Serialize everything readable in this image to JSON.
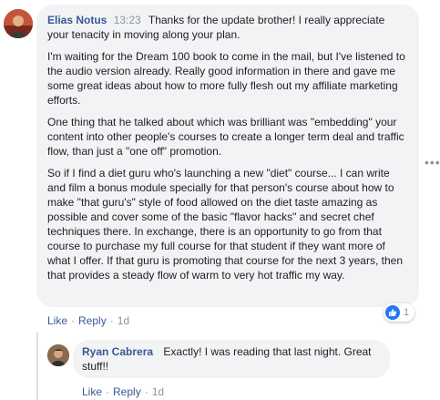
{
  "comment": {
    "author": "Elias Notus",
    "time": "13:23",
    "paragraphs": [
      "Thanks for the update brother! I really appreciate your tenacity in moving along your plan.",
      "I'm waiting for the Dream 100 book to come in the mail, but I've listened to the audio version already. Really good information in there and gave me some great ideas about how to more fully flesh out my affiliate marketing efforts.",
      "One thing that he talked about which was brilliant was \"embedding\" your content into other people's courses to create a longer term deal and traffic flow, than just a \"one off\" promotion.",
      "So if I find a diet guru who's launching a new \"diet\" course... I can write and film a bonus module specially for that person's course about how to make \"that guru's\" style of food allowed on the diet taste amazing as possible and cover some of the basic \"flavor hacks\" and secret chef techniques there. In exchange, there is an opportunity to go from that course to purchase my full course for that student if they want more of what I offer. If that guru is promoting that course for the next 3 years, then that provides a steady flow of warm to very hot traffic my way."
    ],
    "reaction_count": "1",
    "actions": {
      "like": "Like",
      "reply": "Reply",
      "age": "1d"
    }
  },
  "reply": {
    "author": "Ryan Cabrera",
    "text": "Exactly! I was reading that last night. Great stuff!!",
    "actions": {
      "like": "Like",
      "reply": "Reply",
      "age": "1d"
    }
  },
  "colors": {
    "link": "#385898",
    "bubble": "#f2f3f5",
    "meta": "#90949c",
    "like_blue": "#2078f4"
  },
  "icons": {
    "reaction": "thumbs-up-icon",
    "more": "more-options-icon"
  }
}
